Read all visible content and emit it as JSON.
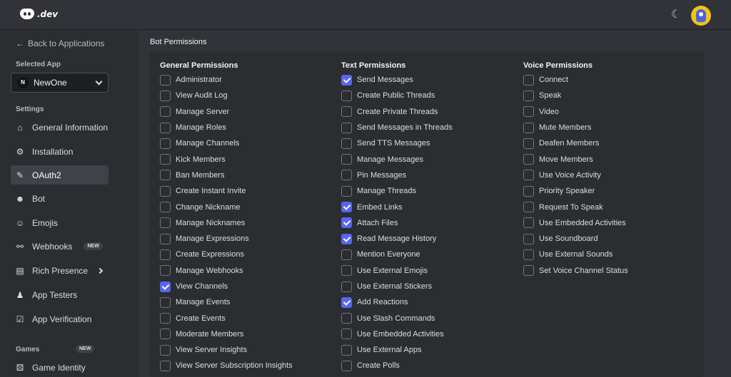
{
  "topbar": {
    "logo_text": ".dev",
    "theme_icon": "moon-icon",
    "avatar_icon": "avatar"
  },
  "sidebar": {
    "back_label": "Back to Applications",
    "selected_app_label": "Selected App",
    "app": {
      "initial": "N",
      "name": "NewOne"
    },
    "settings_label": "Settings",
    "items": [
      {
        "label": "General Information",
        "icon": "home-icon"
      },
      {
        "label": "Installation",
        "icon": "gear-icon"
      },
      {
        "label": "OAuth2",
        "icon": "wrench-icon",
        "active": true
      },
      {
        "label": "Bot",
        "icon": "robot-icon"
      },
      {
        "label": "Emojis",
        "icon": "smiley-icon"
      },
      {
        "label": "Webhooks",
        "icon": "webhook-icon",
        "badge": "NEW"
      },
      {
        "label": "Rich Presence",
        "icon": "presence-icon"
      },
      {
        "label": "App Testers",
        "icon": "person-icon"
      },
      {
        "label": "App Verification",
        "icon": "clipboard-check-icon"
      }
    ],
    "games_label": "Games",
    "games_badge": "NEW",
    "game_items": [
      {
        "label": "Game Identity",
        "icon": "dice-icon"
      }
    ]
  },
  "main": {
    "title": "Bot Permissions",
    "columns": [
      {
        "heading": "General Permissions",
        "items": [
          {
            "label": "Administrator",
            "checked": false
          },
          {
            "label": "View Audit Log",
            "checked": false
          },
          {
            "label": "Manage Server",
            "checked": false
          },
          {
            "label": "Manage Roles",
            "checked": false
          },
          {
            "label": "Manage Channels",
            "checked": false
          },
          {
            "label": "Kick Members",
            "checked": false
          },
          {
            "label": "Ban Members",
            "checked": false
          },
          {
            "label": "Create Instant Invite",
            "checked": false
          },
          {
            "label": "Change Nickname",
            "checked": false
          },
          {
            "label": "Manage Nicknames",
            "checked": false
          },
          {
            "label": "Manage Expressions",
            "checked": false
          },
          {
            "label": "Create Expressions",
            "checked": false
          },
          {
            "label": "Manage Webhooks",
            "checked": false
          },
          {
            "label": "View Channels",
            "checked": true
          },
          {
            "label": "Manage Events",
            "checked": false
          },
          {
            "label": "Create Events",
            "checked": false
          },
          {
            "label": "Moderate Members",
            "checked": false
          },
          {
            "label": "View Server Insights",
            "checked": false
          },
          {
            "label": "View Server Subscription Insights",
            "checked": false
          }
        ]
      },
      {
        "heading": "Text Permissions",
        "items": [
          {
            "label": "Send Messages",
            "checked": true
          },
          {
            "label": "Create Public Threads",
            "checked": false
          },
          {
            "label": "Create Private Threads",
            "checked": false
          },
          {
            "label": "Send Messages in Threads",
            "checked": false
          },
          {
            "label": "Send TTS Messages",
            "checked": false
          },
          {
            "label": "Manage Messages",
            "checked": false
          },
          {
            "label": "Pin Messages",
            "checked": false
          },
          {
            "label": "Manage Threads",
            "checked": false
          },
          {
            "label": "Embed Links",
            "checked": true
          },
          {
            "label": "Attach Files",
            "checked": true
          },
          {
            "label": "Read Message History",
            "checked": true
          },
          {
            "label": "Mention Everyone",
            "checked": false
          },
          {
            "label": "Use External Emojis",
            "checked": false
          },
          {
            "label": "Use External Stickers",
            "checked": false
          },
          {
            "label": "Add Reactions",
            "checked": true
          },
          {
            "label": "Use Slash Commands",
            "checked": false
          },
          {
            "label": "Use Embedded Activities",
            "checked": false
          },
          {
            "label": "Use External Apps",
            "checked": false
          },
          {
            "label": "Create Polls",
            "checked": false
          }
        ]
      },
      {
        "heading": "Voice Permissions",
        "items": [
          {
            "label": "Connect",
            "checked": false
          },
          {
            "label": "Speak",
            "checked": false
          },
          {
            "label": "Video",
            "checked": false
          },
          {
            "label": "Mute Members",
            "checked": false
          },
          {
            "label": "Deafen Members",
            "checked": false
          },
          {
            "label": "Move Members",
            "checked": false
          },
          {
            "label": "Use Voice Activity",
            "checked": false
          },
          {
            "label": "Priority Speaker",
            "checked": false
          },
          {
            "label": "Request To Speak",
            "checked": false
          },
          {
            "label": "Use Embedded Activities",
            "checked": false
          },
          {
            "label": "Use Soundboard",
            "checked": false
          },
          {
            "label": "Use External Sounds",
            "checked": false
          },
          {
            "label": "Set Voice Channel Status",
            "checked": false
          }
        ]
      }
    ]
  },
  "colors": {
    "accent": "#5865f2",
    "background": "#313338",
    "sidebar": "#2b2d31"
  }
}
